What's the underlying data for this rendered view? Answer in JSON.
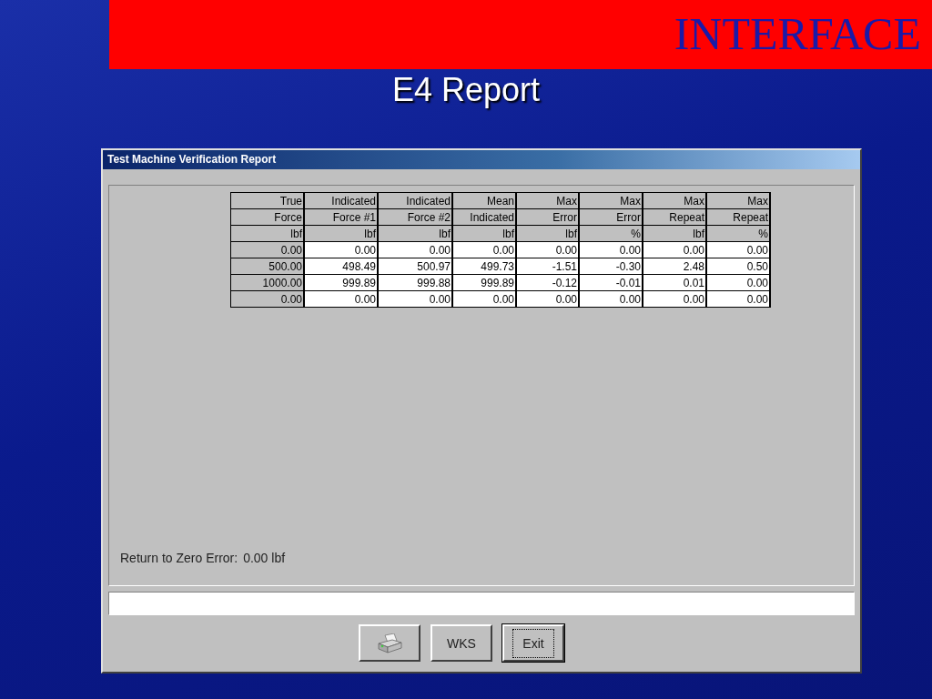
{
  "slide": {
    "banner": "INTERFACE",
    "title": "E4 Report"
  },
  "window": {
    "title": "Test Machine Verification Report"
  },
  "table": {
    "header_rows": [
      [
        "True",
        "Indicated",
        "Indicated",
        "Mean",
        "Max",
        "Max",
        "Max",
        "Max"
      ],
      [
        "Force",
        "Force #1",
        "Force #2",
        "Indicated",
        "Error",
        "Error",
        "Repeat",
        "Repeat"
      ],
      [
        "lbf",
        "lbf",
        "lbf",
        "lbf",
        "lbf",
        "%",
        "lbf",
        "%"
      ]
    ],
    "rows": [
      [
        "0.00",
        "0.00",
        "0.00",
        "0.00",
        "0.00",
        "0.00",
        "0.00",
        "0.00"
      ],
      [
        "500.00",
        "498.49",
        "500.97",
        "499.73",
        "-1.51",
        "-0.30",
        "2.48",
        "0.50"
      ],
      [
        "1000.00",
        "999.89",
        "999.88",
        "999.89",
        "-0.12",
        "-0.01",
        "0.01",
        "0.00"
      ],
      [
        "0.00",
        "0.00",
        "0.00",
        "0.00",
        "0.00",
        "0.00",
        "0.00",
        "0.00"
      ]
    ]
  },
  "return_to_zero": {
    "label": "Return to Zero Error:",
    "value": "0.00 lbf"
  },
  "buttons": [
    {
      "kind": "icon",
      "default": false
    },
    {
      "kind": "text",
      "label": "WKS",
      "default": false
    },
    {
      "kind": "text",
      "label": "Exit",
      "default": true
    }
  ]
}
